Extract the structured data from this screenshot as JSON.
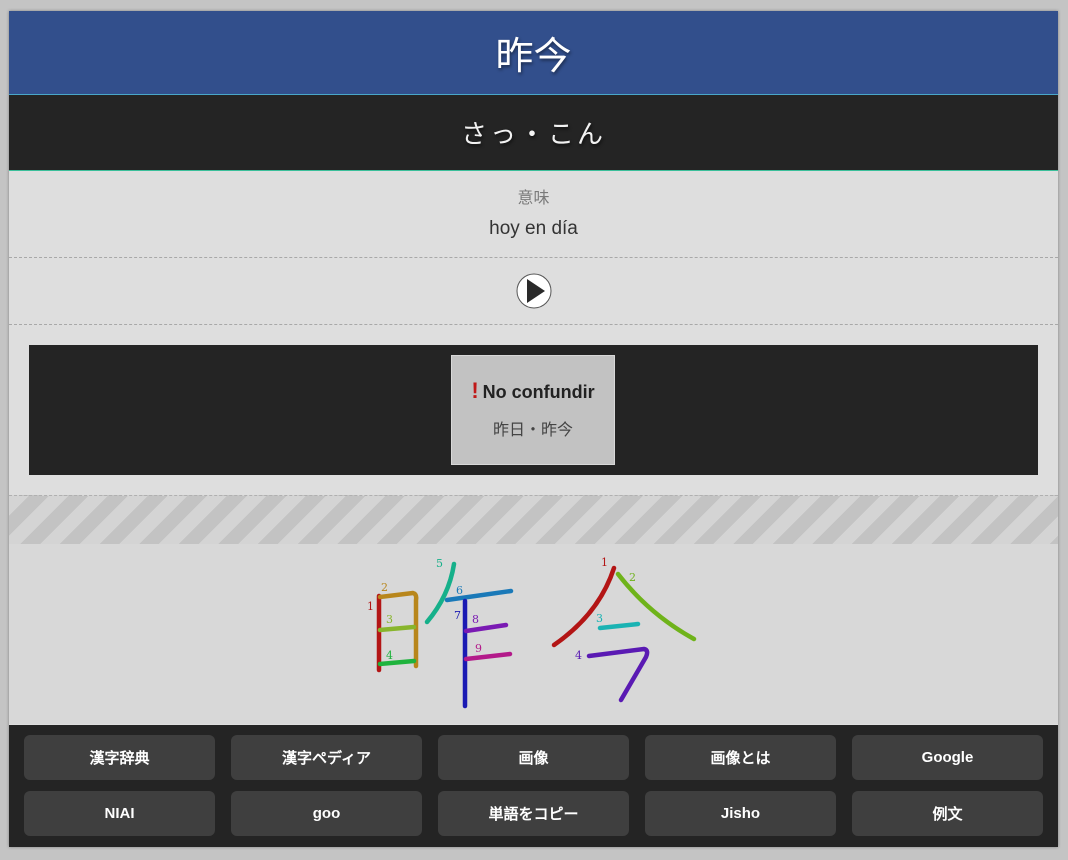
{
  "header": {
    "word": "昨今"
  },
  "reading": "さっ・こん",
  "meaning": {
    "label": "意味",
    "value": "hoy en día"
  },
  "confusion": {
    "icon": "!",
    "title": "No confundir",
    "words": "昨日・昨今"
  },
  "stroke_numbers": {
    "k1": [
      "1",
      "2",
      "3",
      "4",
      "5",
      "6",
      "7",
      "8",
      "9"
    ],
    "k2": [
      "1",
      "2",
      "3",
      "4"
    ]
  },
  "links": [
    "漢字辞典",
    "漢字ペディア",
    "画像",
    "画像とは",
    "Google",
    "NIAI",
    "goo",
    "単語をコピー",
    "Jisho",
    "例文"
  ]
}
